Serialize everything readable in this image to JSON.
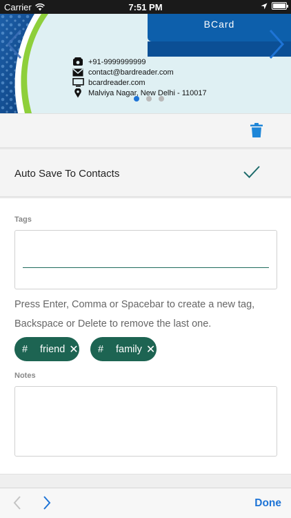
{
  "status_bar": {
    "carrier": "Carrier",
    "time": "7:51 PM"
  },
  "card": {
    "brand": "BCard",
    "phone": "+91-9999999999",
    "email": "contact@bardreader.com",
    "website": "bcardreader.com",
    "address": "Malviya Nagar, New Delhi - 110017",
    "page_count": 3,
    "active_page": 1
  },
  "autosave": {
    "label": "Auto Save To Contacts",
    "checked": true
  },
  "tags": {
    "label": "Tags",
    "hint": "Press Enter, Comma or Spacebar to create a new tag, Backspace or Delete to remove the last one.",
    "items": [
      {
        "hash": "#",
        "text": "friend",
        "remove": "✕"
      },
      {
        "hash": "#",
        "text": "family",
        "remove": "✕"
      }
    ]
  },
  "notes": {
    "label": "Notes",
    "value": ""
  },
  "toolbar": {
    "done": "Done"
  },
  "colors": {
    "accent": "#1e74d6",
    "tag": "#1d6452",
    "brand": "#0d5fab"
  }
}
